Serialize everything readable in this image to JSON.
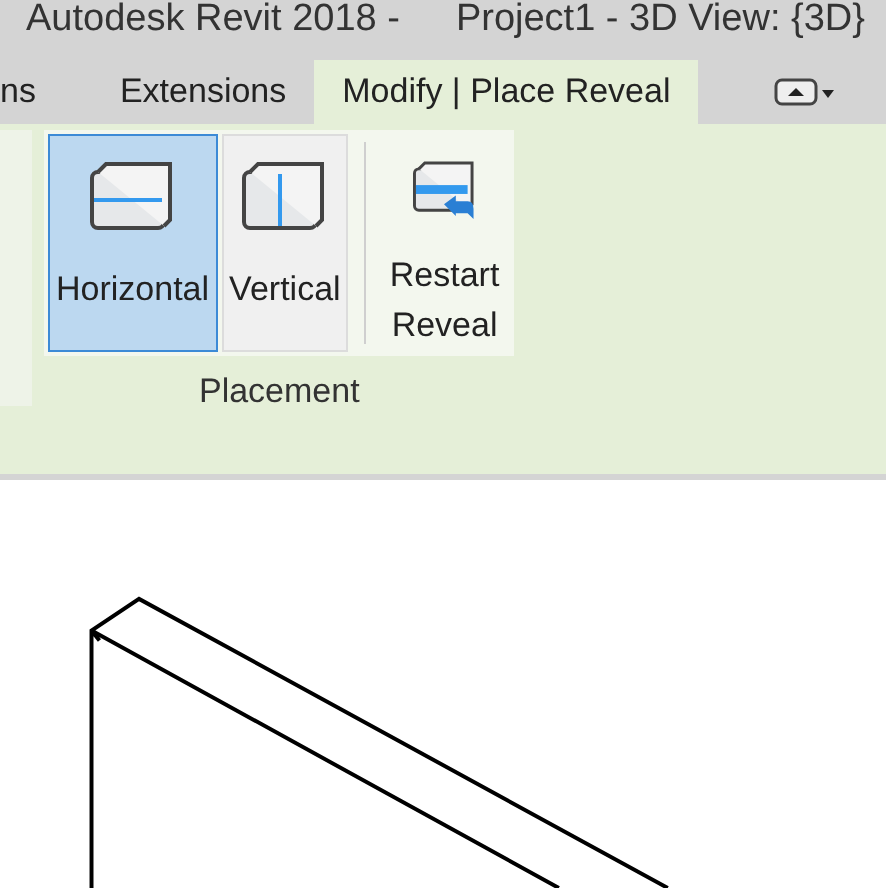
{
  "window": {
    "title_app": "Autodesk Revit 2018 -",
    "title_doc": "Project1 - 3D View: {3D}"
  },
  "tabs": [
    {
      "label": "ns",
      "selected": false
    },
    {
      "label": "Extensions",
      "selected": false
    },
    {
      "label": "Modify | Place Reveal",
      "selected": true
    }
  ],
  "ribbon": {
    "panel_label": "Placement",
    "buttons": [
      {
        "kind": "horizontal",
        "label": "Horizontal",
        "selected": true
      },
      {
        "kind": "vertical",
        "label": "Vertical",
        "selected": false
      },
      {
        "kind": "restart",
        "label": "Restart Reveal",
        "selected": false
      }
    ]
  }
}
